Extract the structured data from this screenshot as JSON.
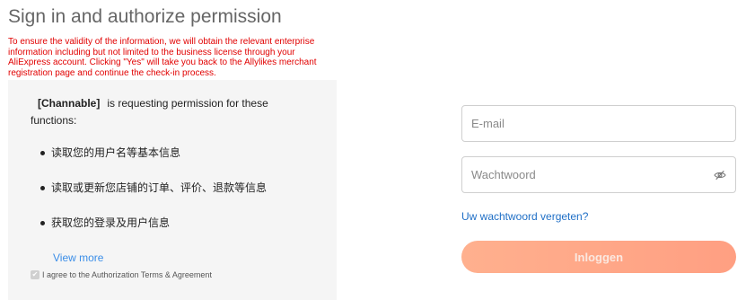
{
  "header": {
    "title": "Sign in and authorize permission",
    "notice": "To ensure the validity of the information, we will obtain the relevant enterprise information including but not limited to the business license through your AliExpress account. Clicking \"Yes\" will take you back to the Allylikes merchant registration page and continue the check-in process."
  },
  "authorization": {
    "app_name": "[Channable]",
    "request_text": "is requesting permission for these functions:",
    "permissions": [
      "读取您的用户名等基本信息",
      "读取或更新您店铺的订单、评价、退款等信息",
      "获取您的登录及用户信息"
    ],
    "view_more": "View more",
    "agree_checked": true,
    "agree_label": "I agree to the Authorization Terms & Agreement"
  },
  "login": {
    "email_placeholder": "E-mail",
    "email_value": "",
    "password_placeholder": "Wachtwoord",
    "password_value": "",
    "forgot_label": "Uw wachtwoord vergeten?",
    "submit_label": "Inloggen",
    "password_icon": "eye-slash-icon"
  },
  "colors": {
    "notice_text": "#e10000",
    "link": "#1f6fc6",
    "button_gradient_start": "#ffb08e",
    "button_gradient_end": "#ff9f82",
    "panel_bg": "#f5f5f5"
  }
}
